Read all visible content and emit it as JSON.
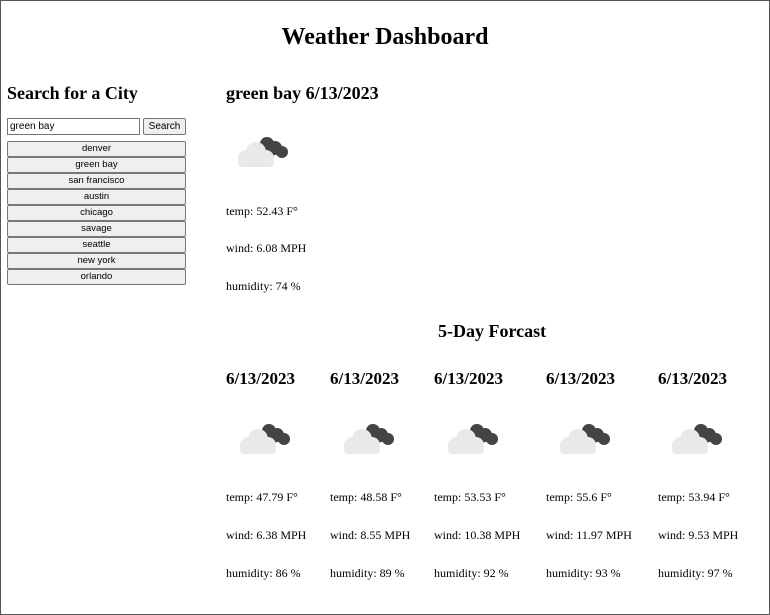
{
  "page": {
    "title": "Weather Dashboard"
  },
  "sidebar": {
    "heading": "Search for a City",
    "search_value": "green bay",
    "search_button": "Search",
    "history": [
      "denver",
      "green bay",
      "san francisco",
      "austin",
      "chicago",
      "savage",
      "seattle",
      "new york",
      "orlando"
    ]
  },
  "current": {
    "heading": "green bay 6/13/2023",
    "icon": "cloud-icon",
    "temp": "temp: 52.43 F°",
    "wind": "wind: 6.08 MPH",
    "humidity": "humidity: 74 %"
  },
  "forecast": {
    "heading": "5-Day Forcast",
    "days": [
      {
        "date": "6/13/2023",
        "icon": "cloud-icon",
        "temp": "temp: 47.79 F°",
        "wind": "wind: 6.38 MPH",
        "humidity": "humidity: 86 %"
      },
      {
        "date": "6/13/2023",
        "icon": "cloud-icon",
        "temp": "temp: 48.58 F°",
        "wind": "wind: 8.55 MPH",
        "humidity": "humidity: 89 %"
      },
      {
        "date": "6/13/2023",
        "icon": "cloud-icon",
        "temp": "temp: 53.53 F°",
        "wind": "wind: 10.38 MPH",
        "humidity": "humidity: 92 %"
      },
      {
        "date": "6/13/2023",
        "icon": "cloud-icon",
        "temp": "temp: 55.6 F°",
        "wind": "wind: 11.97 MPH",
        "humidity": "humidity: 93 %"
      },
      {
        "date": "6/13/2023",
        "icon": "cloud-icon",
        "temp": "temp: 53.94 F°",
        "wind": "wind: 9.53 MPH",
        "humidity": "humidity: 97 %"
      }
    ]
  },
  "colors": {
    "light_cloud": "#e9e9e9",
    "dark_cloud": "#444444"
  }
}
